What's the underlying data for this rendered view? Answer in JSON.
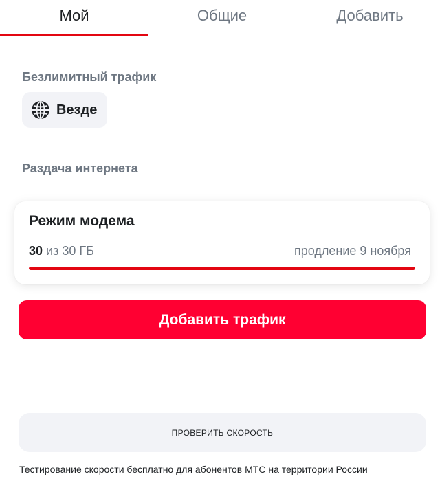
{
  "tabs": [
    {
      "label": "Мой",
      "active": true
    },
    {
      "label": "Общие",
      "active": false
    },
    {
      "label": "Добавить",
      "active": false
    }
  ],
  "unlimited": {
    "section_label": "Безлимитный трафик",
    "chip_icon": "globe-icon",
    "chip_label": "Везде"
  },
  "sharing": {
    "section_label": "Раздача интернета",
    "card": {
      "title": "Режим модема",
      "used": "30",
      "total_text": "из 30 ГБ",
      "renewal": "продление 9 ноября",
      "progress_fraction": 1.0
    }
  },
  "add_traffic_button": "Добавить трафик",
  "speed_test": {
    "button_label": "ПРОВЕРИТЬ СКОРОСТЬ",
    "footnote": "Тестирование скорости бесплатно для абонентов МТС на территории России"
  },
  "colors": {
    "accent": "#ff0032",
    "progress": "#e30611",
    "muted_text": "#6e7782",
    "chip_bg": "#f2f3f7"
  }
}
